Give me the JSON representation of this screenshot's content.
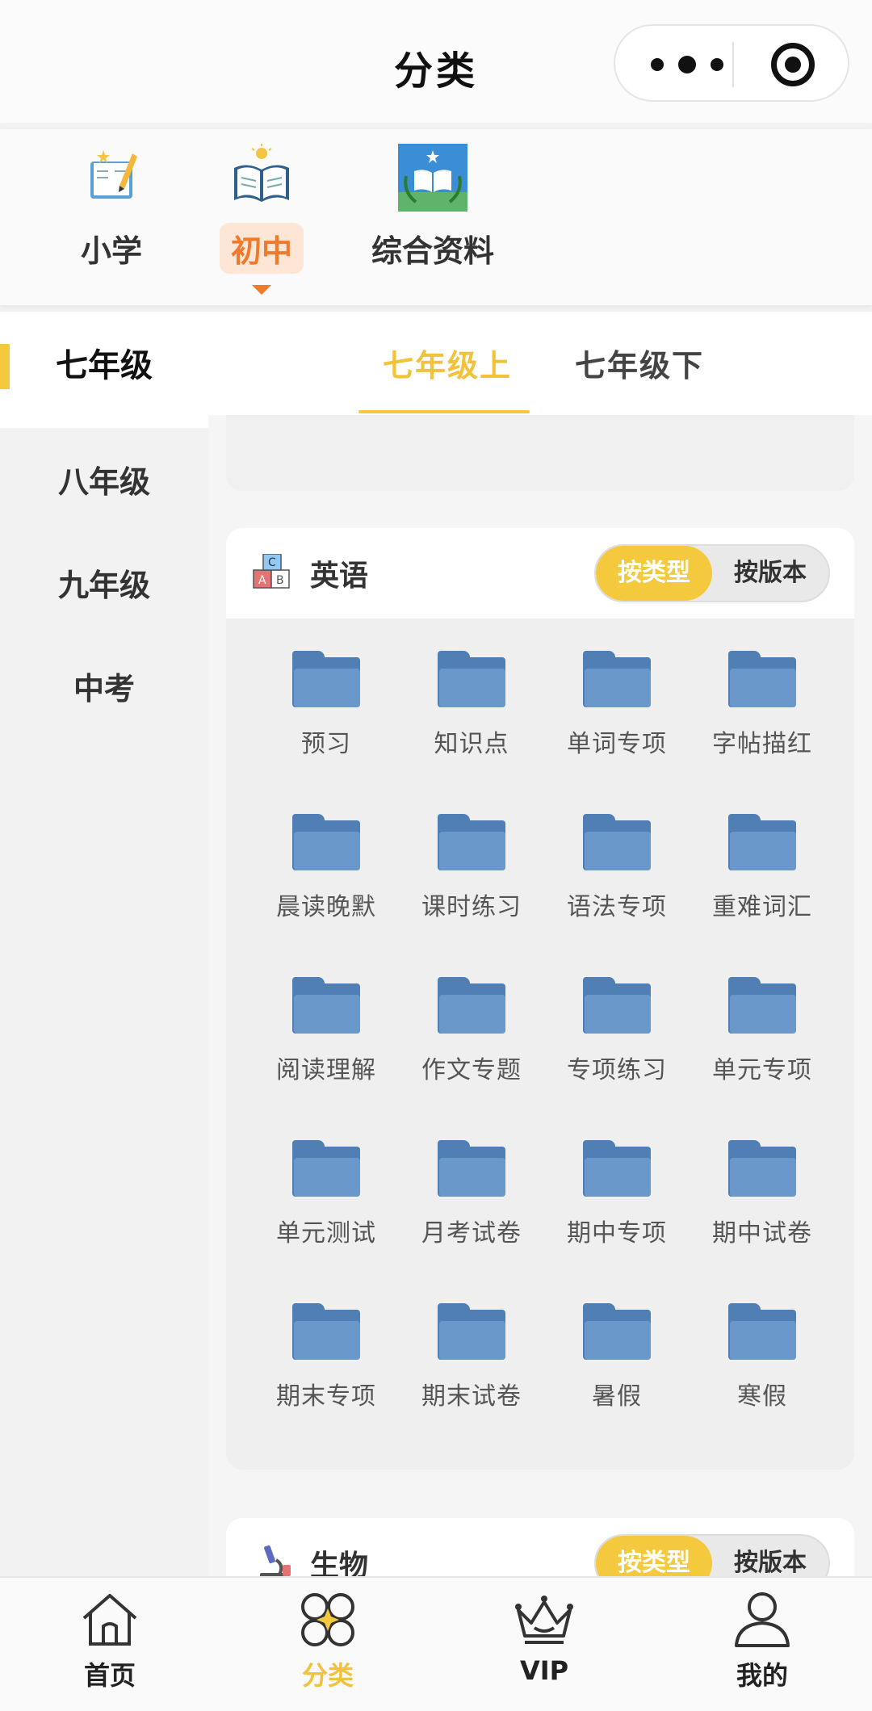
{
  "header": {
    "title": "分类"
  },
  "levels": [
    {
      "label": "小学",
      "icon": "notebook-pencil-icon"
    },
    {
      "label": "初中",
      "icon": "open-book-lightbulb-icon",
      "active": true
    },
    {
      "label": "综合资料",
      "icon": "book-laurel-icon"
    }
  ],
  "sidebar": {
    "items": [
      {
        "label": "七年级",
        "active": true
      },
      {
        "label": "八年级"
      },
      {
        "label": "九年级"
      },
      {
        "label": "中考"
      }
    ]
  },
  "grade_tabs": [
    {
      "label": "七年级上",
      "active": true
    },
    {
      "label": "七年级下"
    }
  ],
  "subjects": [
    {
      "name": "英语",
      "icon": "abc-blocks-icon",
      "toggle": {
        "by_type": "按类型",
        "by_edition": "按版本",
        "selected": "by_type"
      },
      "categories": [
        "预习",
        "知识点",
        "单词专项",
        "字帖描红",
        "晨读晚默",
        "课时练习",
        "语法专项",
        "重难词汇",
        "阅读理解",
        "作文专题",
        "专项练习",
        "单元专项",
        "单元测试",
        "月考试卷",
        "期中专项",
        "期中试卷",
        "期末专项",
        "期末试卷",
        "暑假",
        "寒假"
      ]
    },
    {
      "name": "生物",
      "icon": "microscope-icon",
      "toggle": {
        "by_type": "按类型",
        "by_edition": "按版本",
        "selected": "by_type"
      }
    }
  ],
  "tabbar": [
    {
      "label": "首页",
      "icon": "home-icon"
    },
    {
      "label": "分类",
      "icon": "category-icon",
      "active": true
    },
    {
      "label": "VIP",
      "icon": "crown-icon"
    },
    {
      "label": "我的",
      "icon": "user-icon"
    }
  ],
  "colors": {
    "accent": "#f4c93d",
    "level_active": "#f07a2b",
    "folder": "#6b98cb"
  }
}
